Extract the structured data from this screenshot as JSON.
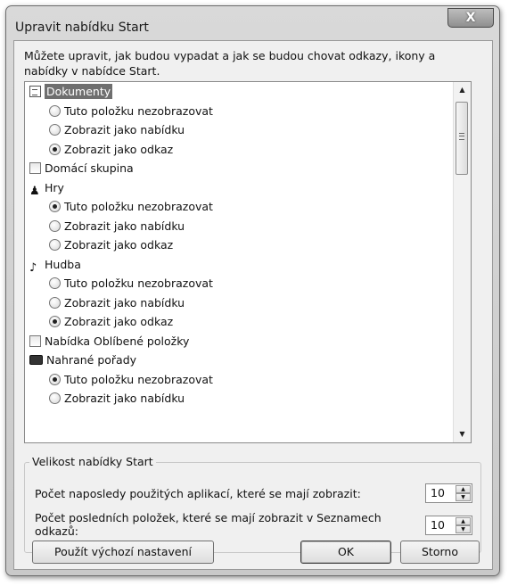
{
  "window": {
    "title": "Upravit nabídku Start",
    "close_glyph": "X"
  },
  "description": "Můžete upravit, jak budou vypadat a jak se budou chovat odkazy, ikony a nabídky v nabídce Start.",
  "list": {
    "items": [
      {
        "kind": "category",
        "icon": "document-icon",
        "label": "Dokumenty",
        "selected": true
      },
      {
        "kind": "option",
        "label": "Tuto položku nezobrazovat",
        "checked": false
      },
      {
        "kind": "option",
        "label": "Zobrazit jako nabídku",
        "checked": false
      },
      {
        "kind": "option",
        "label": "Zobrazit jako odkaz",
        "checked": true
      },
      {
        "kind": "checkbox",
        "label": "Domácí skupina",
        "checked": false
      },
      {
        "kind": "category",
        "icon": "games-icon",
        "label": "Hry"
      },
      {
        "kind": "option",
        "label": "Tuto položku nezobrazovat",
        "checked": true
      },
      {
        "kind": "option",
        "label": "Zobrazit jako nabídku",
        "checked": false
      },
      {
        "kind": "option",
        "label": "Zobrazit jako odkaz",
        "checked": false
      },
      {
        "kind": "category",
        "icon": "music-note-icon",
        "label": "Hudba"
      },
      {
        "kind": "option",
        "label": "Tuto položku nezobrazovat",
        "checked": false
      },
      {
        "kind": "option",
        "label": "Zobrazit jako nabídku",
        "checked": false
      },
      {
        "kind": "option",
        "label": "Zobrazit jako odkaz",
        "checked": true
      },
      {
        "kind": "checkbox",
        "label": "Nabídka Oblíbené položky",
        "checked": false
      },
      {
        "kind": "category",
        "icon": "tv-icon",
        "label": "Nahrané pořady"
      },
      {
        "kind": "option",
        "label": "Tuto položku nezobrazovat",
        "checked": true
      },
      {
        "kind": "option",
        "label": "Zobrazit jako nabídku",
        "checked": false
      }
    ]
  },
  "size_group": {
    "legend": "Velikost nabídky Start",
    "recent_apps_label": "Počet naposledy použitých aplikací, které se mají zobrazit:",
    "recent_apps_value": "10",
    "jump_list_label": "Počet posledních položek, které se mají zobrazit v Seznamech odkazů:",
    "jump_list_value": "10"
  },
  "buttons": {
    "defaults": "Použít výchozí nastavení",
    "ok": "OK",
    "cancel": "Storno"
  }
}
